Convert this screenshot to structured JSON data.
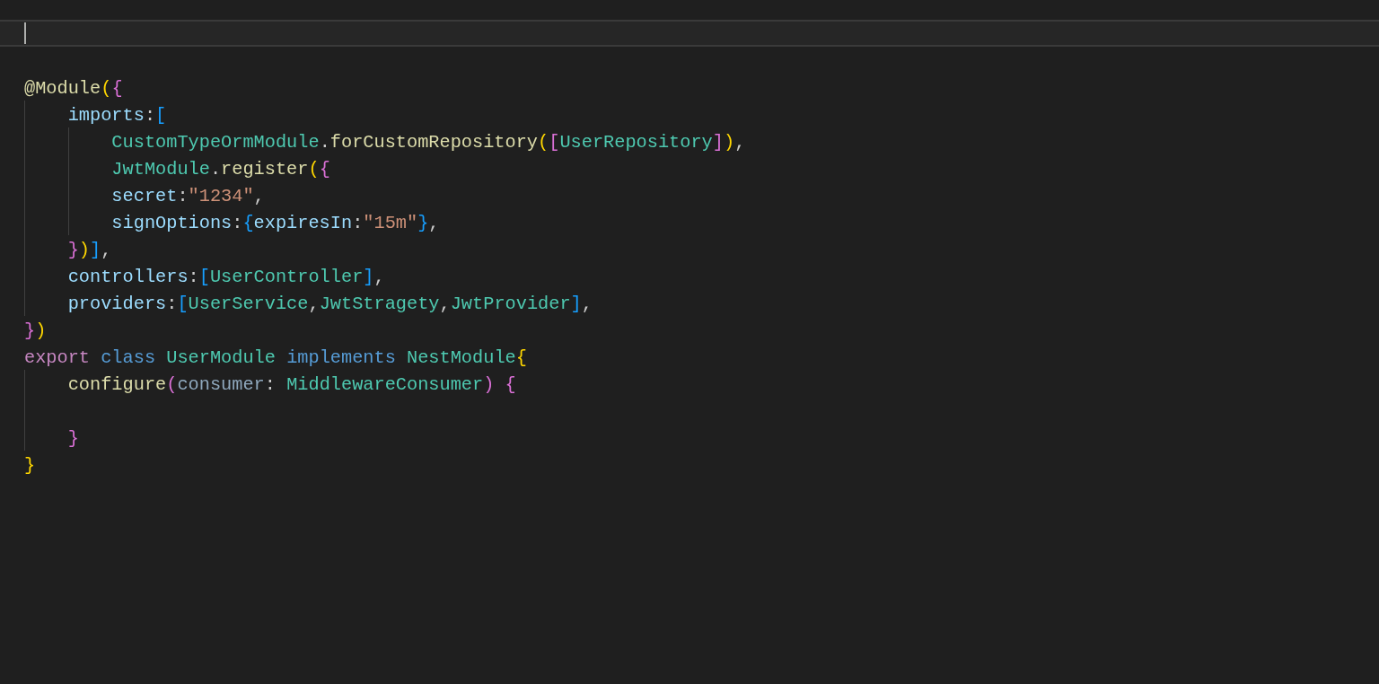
{
  "editor": {
    "lines": [
      {
        "current": true
      },
      {
        "current": false
      },
      {
        "current": false,
        "tokens": [
          {
            "text": "@Module",
            "kind": "func"
          },
          {
            "text": "(",
            "kind": "b1"
          },
          {
            "text": "{",
            "kind": "b2"
          }
        ]
      },
      {
        "current": false,
        "tokens": [
          {
            "text": "    imports",
            "kind": "property"
          },
          {
            "text": ":",
            "kind": "plain"
          },
          {
            "text": "[",
            "kind": "b3"
          }
        ]
      },
      {
        "current": false,
        "tokens": [
          {
            "text": "        CustomTypeOrmModule",
            "kind": "type"
          },
          {
            "text": ".",
            "kind": "plain"
          },
          {
            "text": "forCustomRepository",
            "kind": "func"
          },
          {
            "text": "(",
            "kind": "b1"
          },
          {
            "text": "[",
            "kind": "b2"
          },
          {
            "text": "UserRepository",
            "kind": "type"
          },
          {
            "text": "]",
            "kind": "b2"
          },
          {
            "text": ")",
            "kind": "b1"
          },
          {
            "text": ",",
            "kind": "plain"
          }
        ]
      },
      {
        "current": false,
        "tokens": [
          {
            "text": "        JwtModule",
            "kind": "type"
          },
          {
            "text": ".",
            "kind": "plain"
          },
          {
            "text": "register",
            "kind": "func"
          },
          {
            "text": "(",
            "kind": "b1"
          },
          {
            "text": "{",
            "kind": "b2"
          }
        ]
      },
      {
        "current": false,
        "tokens": [
          {
            "text": "        secret",
            "kind": "property"
          },
          {
            "text": ":",
            "kind": "plain"
          },
          {
            "text": "\"1234\"",
            "kind": "string"
          },
          {
            "text": ",",
            "kind": "plain"
          }
        ]
      },
      {
        "current": false,
        "tokens": [
          {
            "text": "        signOptions",
            "kind": "property"
          },
          {
            "text": ":",
            "kind": "plain"
          },
          {
            "text": "{",
            "kind": "b3"
          },
          {
            "text": "expiresIn",
            "kind": "property"
          },
          {
            "text": ":",
            "kind": "plain"
          },
          {
            "text": "\"15m\"",
            "kind": "string"
          },
          {
            "text": "}",
            "kind": "b3"
          },
          {
            "text": ",",
            "kind": "plain"
          }
        ]
      },
      {
        "current": false,
        "tokens": [
          {
            "text": "    }",
            "kind": "b2"
          },
          {
            "text": ")",
            "kind": "b1"
          },
          {
            "text": "]",
            "kind": "b3"
          },
          {
            "text": ",",
            "kind": "plain"
          }
        ]
      },
      {
        "current": false,
        "tokens": [
          {
            "text": "    controllers",
            "kind": "property"
          },
          {
            "text": ":",
            "kind": "plain"
          },
          {
            "text": "[",
            "kind": "b3"
          },
          {
            "text": "UserController",
            "kind": "type"
          },
          {
            "text": "]",
            "kind": "b3"
          },
          {
            "text": ",",
            "kind": "plain"
          }
        ]
      },
      {
        "current": false,
        "tokens": [
          {
            "text": "    providers",
            "kind": "property"
          },
          {
            "text": ":",
            "kind": "plain"
          },
          {
            "text": "[",
            "kind": "b3"
          },
          {
            "text": "UserService",
            "kind": "type"
          },
          {
            "text": ",",
            "kind": "plain"
          },
          {
            "text": "JwtStragety",
            "kind": "type"
          },
          {
            "text": ",",
            "kind": "plain"
          },
          {
            "text": "JwtProvider",
            "kind": "type"
          },
          {
            "text": "]",
            "kind": "b3"
          },
          {
            "text": ",",
            "kind": "plain"
          }
        ]
      },
      {
        "current": false,
        "tokens": [
          {
            "text": "}",
            "kind": "b2"
          },
          {
            "text": ")",
            "kind": "b1"
          }
        ]
      },
      {
        "current": false,
        "tokens": [
          {
            "text": "export ",
            "kind": "keyword"
          },
          {
            "text": "class ",
            "kind": "storage"
          },
          {
            "text": "UserModule ",
            "kind": "type"
          },
          {
            "text": "implements ",
            "kind": "storage"
          },
          {
            "text": "NestModule",
            "kind": "type"
          },
          {
            "text": "{",
            "kind": "b1"
          }
        ]
      },
      {
        "current": false,
        "tokens": [
          {
            "text": "    configure",
            "kind": "func"
          },
          {
            "text": "(",
            "kind": "b2"
          },
          {
            "text": "consumer",
            "kind": "param"
          },
          {
            "text": ": ",
            "kind": "plain"
          },
          {
            "text": "MiddlewareConsumer",
            "kind": "type"
          },
          {
            "text": ")",
            "kind": "b2"
          },
          {
            "text": " {",
            "kind": "b2"
          }
        ]
      },
      {
        "current": false
      },
      {
        "current": false,
        "tokens": [
          {
            "text": "    }",
            "kind": "b2"
          }
        ]
      },
      {
        "current": false,
        "tokens": [
          {
            "text": "}",
            "kind": "b1"
          }
        ]
      }
    ]
  }
}
